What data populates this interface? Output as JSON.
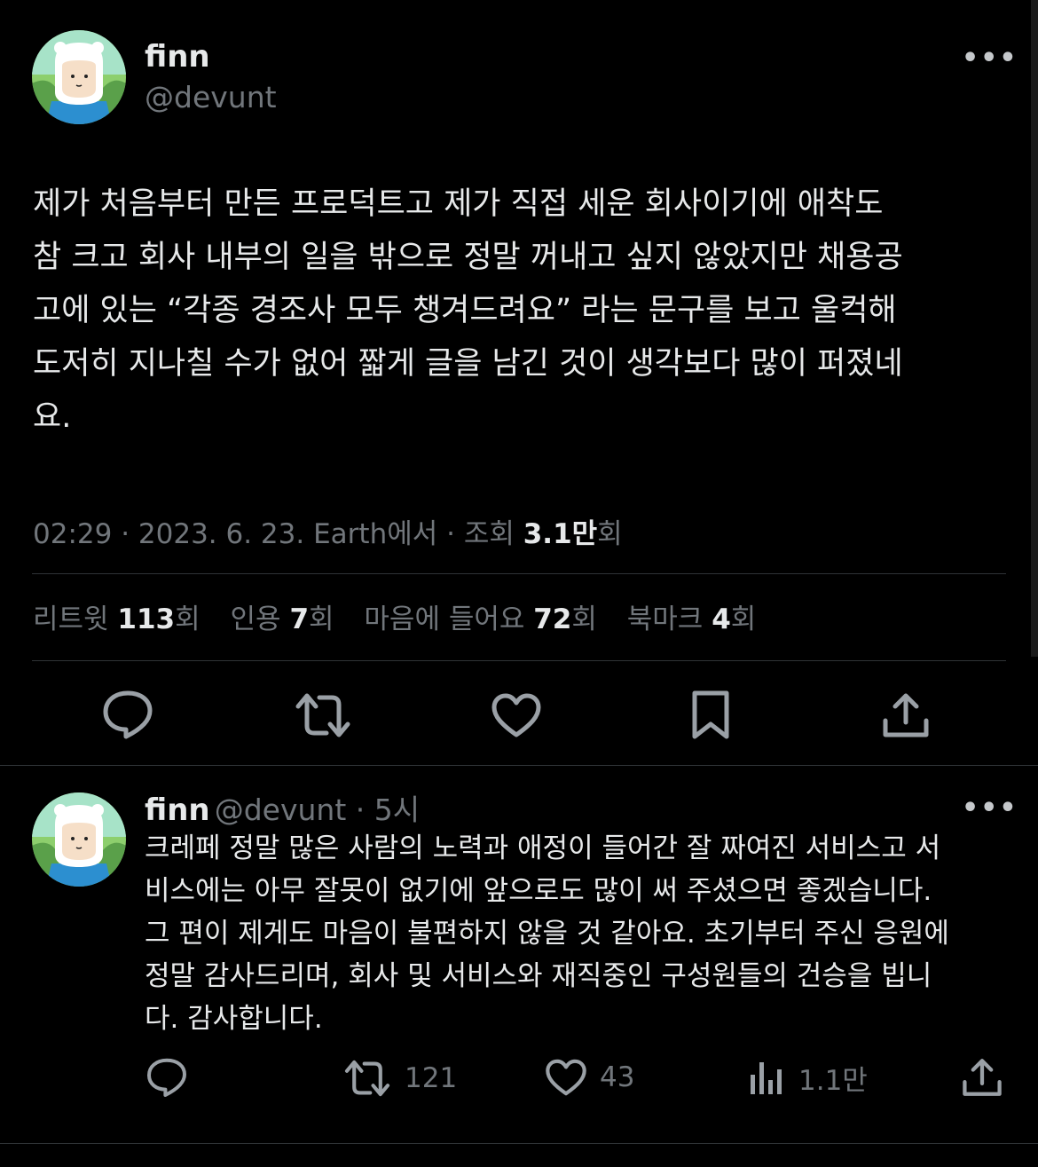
{
  "tweet": {
    "author_name": "finn",
    "author_handle": "@devunt",
    "avatar": "finn-avatar",
    "more_icon": "•••",
    "text_lines": [
      "제가 처음부터 만든 프로덕트고 제가 직접 세운 회사이기에 애착도",
      "참 크고 회사 내부의 일을 밖으로 정말 꺼내고 싶지 않았지만 채용공",
      "고에 있는 “각종 경조사 모두 챙겨드려요” 라는 문구를 보고 울컥해",
      "도저히 지나칠 수가 없어 짧게 글을 남긴 것이 생각보다 많이 퍼졌네",
      "요."
    ],
    "meta": {
      "time": "02:29 · 2023. 6. 23. Earth에서 · 조회 ",
      "views": "3.1만",
      "views_suffix": "회"
    },
    "stats": [
      {
        "label": "리트윗 ",
        "value": "113",
        "suffix": "회"
      },
      {
        "label": "인용 ",
        "value": "7",
        "suffix": "회"
      },
      {
        "label": "마음에 들어요 ",
        "value": "72",
        "suffix": "회"
      },
      {
        "label": "북마크 ",
        "value": "4",
        "suffix": "회"
      }
    ],
    "actions": [
      "reply-icon",
      "retweet-icon",
      "like-icon",
      "bookmark-icon",
      "share-icon"
    ]
  },
  "reply": {
    "author_name": "finn",
    "author_handle": "@devunt",
    "time": " · 5시",
    "avatar": "finn-avatar",
    "more_icon": "•••",
    "text_lines": [
      "크레페 정말 많은 사람의 노력과 애정이 들어간 잘 짜여진 서비스고 서",
      "비스에는 아무 잘못이 없기에 앞으로도 많이 써 주셨으면 좋겠습니다.",
      "그 편이 제게도 마음이 불편하지 않을 것 같아요. 초기부터 주신 응원에",
      "정말 감사드리며, 회사 및 서비스와 재직중인 구성원들의 건승을 빕니",
      "다. 감사합니다."
    ],
    "counts": {
      "retweets": "121",
      "likes": "43",
      "views": "1.1만"
    }
  },
  "colors": {
    "background": "#000000",
    "text": "#e7e9ea",
    "secondary": "#71767b",
    "divider": "#2f3336"
  }
}
